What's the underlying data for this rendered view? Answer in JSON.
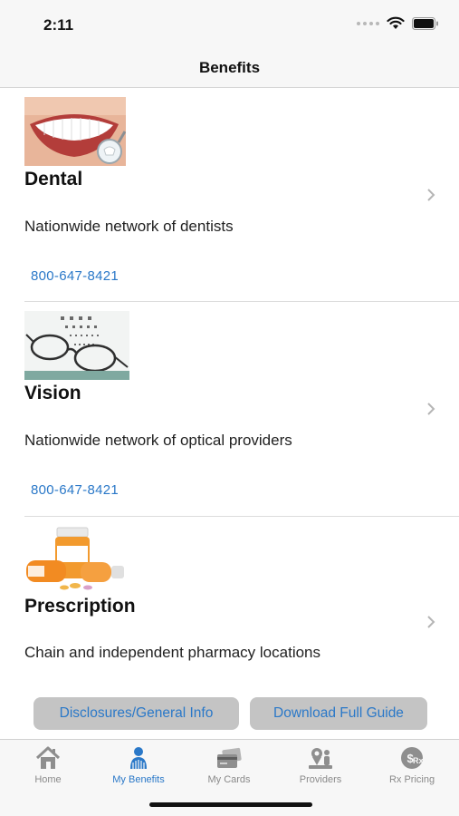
{
  "status_bar": {
    "time": "2:11"
  },
  "nav": {
    "title": "Benefits"
  },
  "benefits": [
    {
      "title": "Dental",
      "description": "Nationwide network of dentists",
      "phone": "800-647-8421",
      "image_icon": "smile-teeth-icon"
    },
    {
      "title": "Vision",
      "description": "Nationwide network of optical providers",
      "phone": "800-647-8421",
      "image_icon": "eyeglasses-eye-chart-icon"
    },
    {
      "title": "Prescription",
      "description": "Chain and independent pharmacy locations",
      "image_icon": "pill-bottles-icon"
    }
  ],
  "actions": {
    "disclosures_label": "Disclosures/General Info",
    "download_label": "Download Full Guide"
  },
  "tabs": [
    {
      "label": "Home",
      "icon": "home-icon",
      "active": false
    },
    {
      "label": "My Benefits",
      "icon": "my-benefits-icon",
      "active": true
    },
    {
      "label": "My Cards",
      "icon": "cards-icon",
      "active": false
    },
    {
      "label": "Providers",
      "icon": "providers-icon",
      "active": false
    },
    {
      "label": "Rx Pricing",
      "icon": "rx-pricing-icon",
      "active": false
    }
  ],
  "colors": {
    "accent": "#2a78c8",
    "tab_inactive": "#8a8a8a",
    "button_bg": "#c4c4c4",
    "bar_bg": "#f7f7f7"
  }
}
